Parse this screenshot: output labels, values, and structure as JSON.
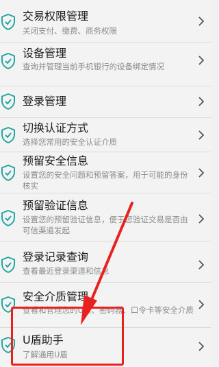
{
  "menu": {
    "items": [
      {
        "title": "交易权限管理",
        "desc": "关闭支付、缴费、商务权限"
      },
      {
        "title": "设备管理",
        "desc": "查询并管理当前手机银行的设备绑定情况"
      },
      {
        "title": "登录管理",
        "desc": ""
      },
      {
        "title": "切换认证方式",
        "desc": "选择您常用的安全认证介质"
      },
      {
        "title": "预留安全信息",
        "desc": "设置您的安全问题和预留答案，用于可能的身份核实"
      },
      {
        "title": "预留验证信息",
        "desc": "设置您的预留验证信息，便于您验证交易是否由可信渠道发起"
      },
      {
        "title": "登录记录查询",
        "desc": "查看最近登录渠道和信息"
      },
      {
        "title": "安全介质管理",
        "desc": "查看和管理您的U盾、密码器、口令卡等安全介质"
      },
      {
        "title": "U盾助手",
        "desc": "了解通用U盾"
      }
    ]
  },
  "icons": {
    "shield": "shield-check-icon",
    "chevron": "chevron-right-icon"
  },
  "colors": {
    "shield": "#23a6a0",
    "annotation": "#e8211f"
  }
}
